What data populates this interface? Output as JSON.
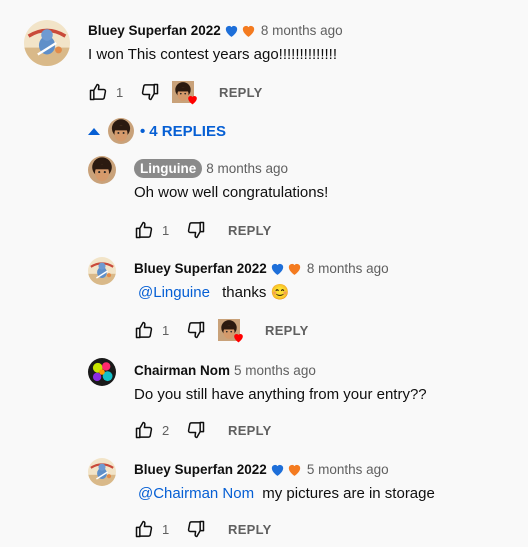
{
  "top": {
    "author": "Bluey Superfan 2022",
    "time": "8 months ago",
    "text": "I won This contest years ago!!!!!!!!!!!!!!",
    "likes": "1",
    "reply_label": "REPLY"
  },
  "replies_toggle": {
    "label": "4 REPLIES",
    "separator": "•"
  },
  "replies": [
    {
      "author": "Linguine",
      "time": "8 months ago",
      "mention": "",
      "text": "Oh wow well congratulations!",
      "likes": "1",
      "reply_label": "REPLY"
    },
    {
      "author": "Bluey Superfan 2022",
      "time": "8 months ago",
      "mention": "@Linguine",
      "text": "thanks 😊",
      "likes": "1",
      "reply_label": "REPLY"
    },
    {
      "author": "Chairman Nom",
      "time": "5 months ago",
      "mention": "",
      "text": "Do you still have anything from your entry??",
      "likes": "2",
      "reply_label": "REPLY"
    },
    {
      "author": "Bluey Superfan 2022",
      "time": "5 months ago",
      "mention": "@Chairman Nom",
      "text": "my pictures are in storage",
      "likes": "1",
      "reply_label": "REPLY"
    }
  ],
  "colors": {
    "link_blue": "#065fd4",
    "heart_blue": "#1e6fd9",
    "heart_orange": "#f47b20",
    "creator_heart": "#ff0000"
  },
  "icons": [
    "like-icon",
    "dislike-icon",
    "creator-heart-icon",
    "blue-heart-icon",
    "orange-heart-icon",
    "collapse-arrow-icon"
  ]
}
